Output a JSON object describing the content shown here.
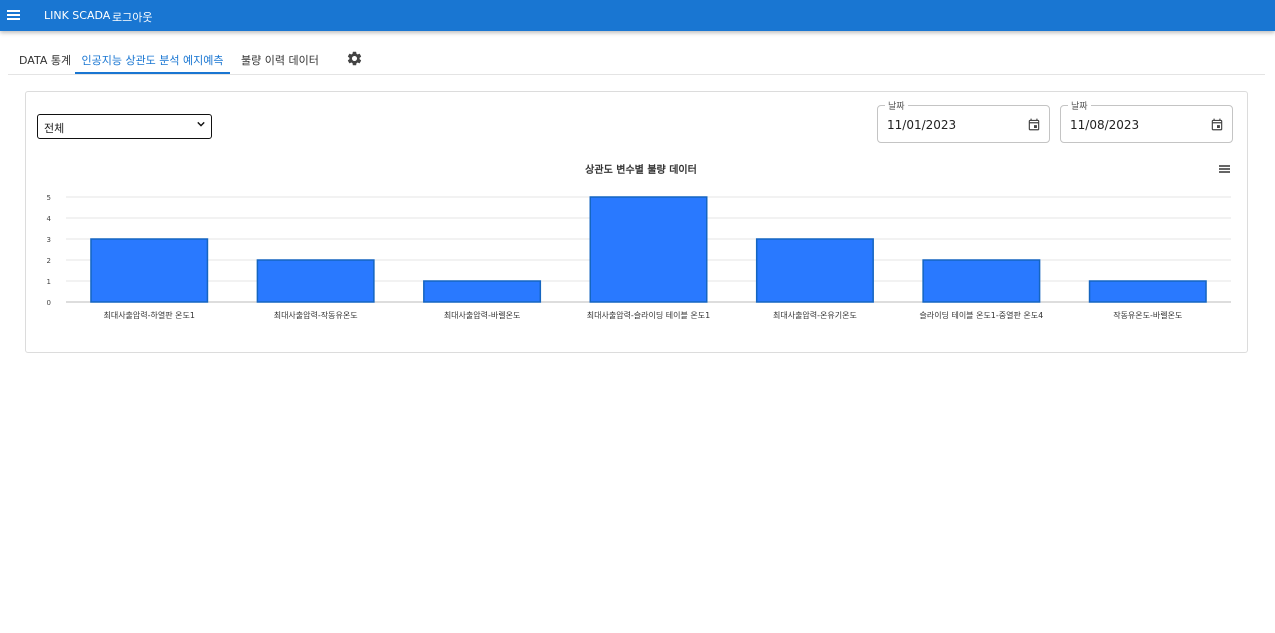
{
  "appbar": {
    "brand": "LINK SCADA",
    "logout": "로그아웃",
    "menu_icon": "hamburger-menu-icon"
  },
  "tabs": [
    {
      "label": "DATA 통계",
      "active": false
    },
    {
      "label": "인공지능 상관도 분석 예지예측",
      "active": true
    },
    {
      "label": "불량 이력 데이터",
      "active": false
    }
  ],
  "settings_icon": "gear-icon",
  "filter": {
    "selected": "전체"
  },
  "dates": [
    {
      "label": "날짜",
      "value": "11/01/2023"
    },
    {
      "label": "날짜",
      "value": "11/08/2023"
    }
  ],
  "colors": {
    "accent": "#1976d2",
    "bar_fill": "#2979ff",
    "bar_stroke": "#1565c0"
  },
  "chart_data": {
    "type": "bar",
    "title": "상관도 변수별 불량 데이터",
    "categories": [
      "최대사출압력-하열판 온도1",
      "최대사출압력-작동유온도",
      "최대사출압력-바렐온도",
      "최대사출압력-슬라이딩 테이블 온도1",
      "최대사출압력-온유기온도",
      "슬라이딩 테이블 온도1-중열판 온도4",
      "작동유온도-바렐온도"
    ],
    "values": [
      3,
      2,
      1,
      5,
      3,
      2,
      1
    ],
    "yticks": [
      "0",
      "1",
      "2",
      "3",
      "4",
      "5"
    ],
    "ylim": [
      0,
      5
    ],
    "grid": true,
    "legend": "none"
  }
}
